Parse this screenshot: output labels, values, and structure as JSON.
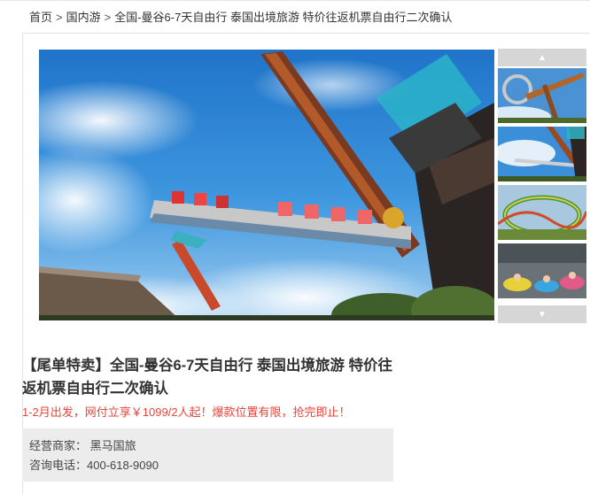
{
  "breadcrumb": {
    "home": "首页",
    "category": "国内游",
    "current": "全国-曼谷6-7天自由行 泰国出境旅游 特价往返机票自由行二次确认",
    "separator": ">"
  },
  "gallery": {
    "up_arrow_icon": "triangle-up-icon",
    "down_arrow_icon": "triangle-down-icon",
    "thumbnails": [
      "pendulum-ride",
      "swing-ride",
      "roller-coaster",
      "bumper-cars"
    ],
    "active_index": 1
  },
  "product": {
    "title": "【尾单特卖】全国-曼谷6-7天自由行 泰国出境旅游 特价往返机票自由行二次确认",
    "promo": "1-2月出发，网付立享￥1099/2人起！爆款位置有限，抢完即止！"
  },
  "info": {
    "merchant_label": "经营商家：",
    "merchant_value": "黑马国旅",
    "phone_label": "咨询电话：",
    "phone_value": "400-618-9090"
  },
  "colors": {
    "promo": "#e8453c",
    "info_bg": "#ececec",
    "arrow_bg": "#d6d6d6"
  }
}
